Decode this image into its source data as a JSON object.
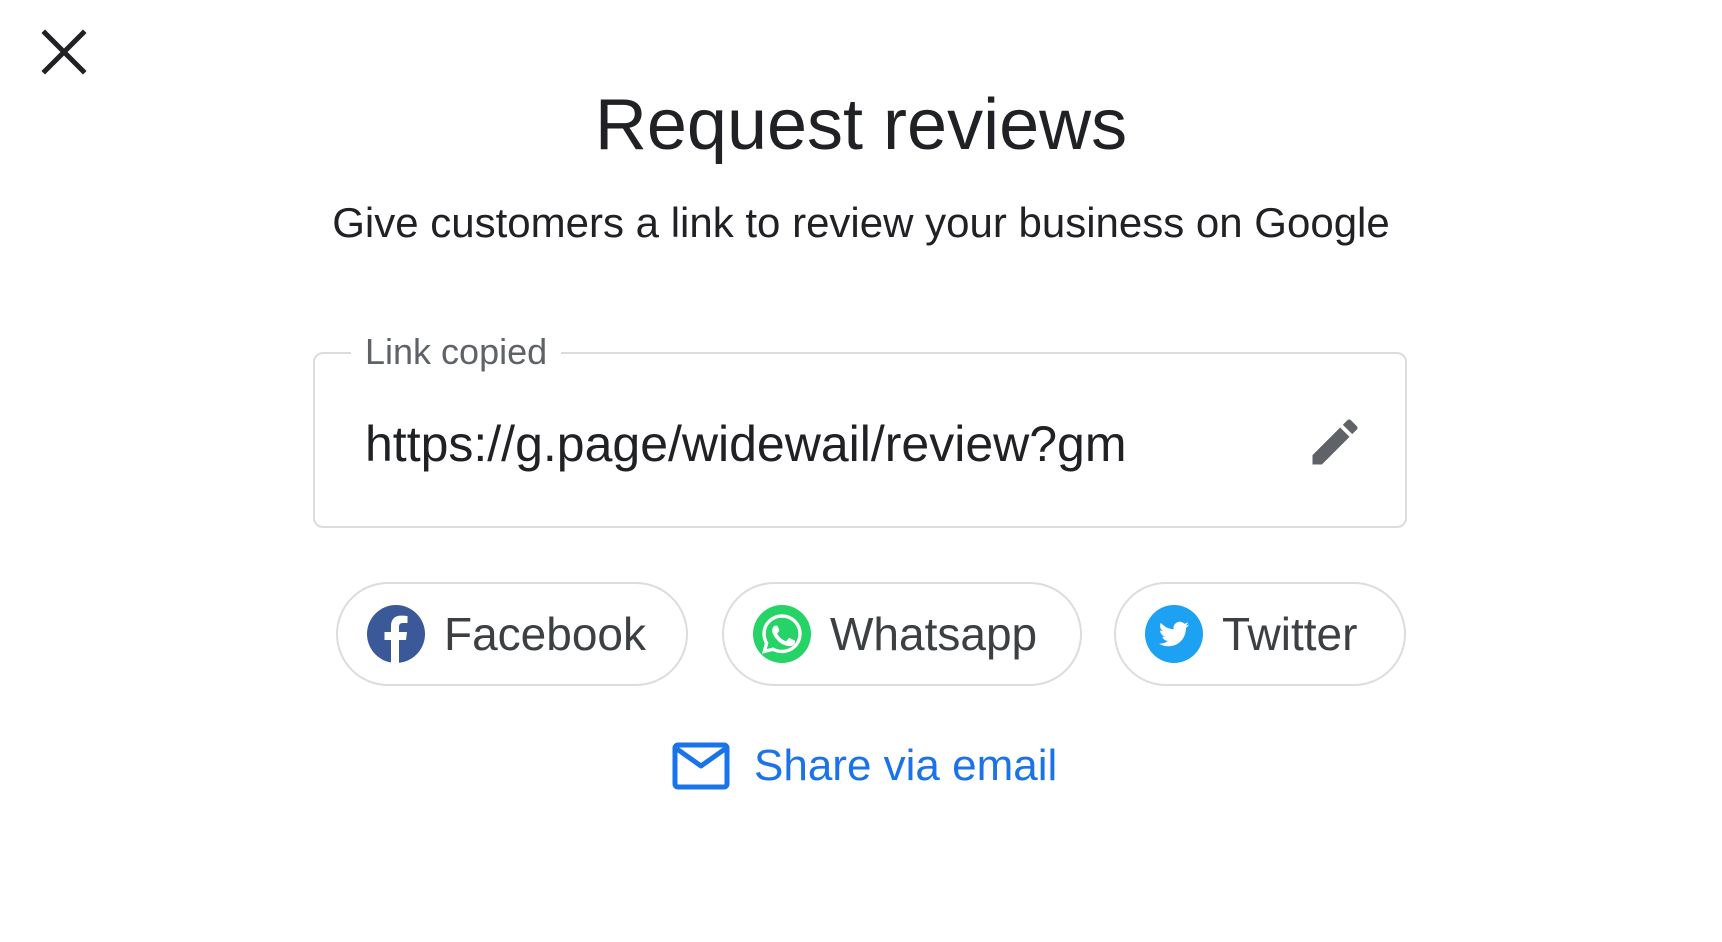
{
  "dialog": {
    "title": "Request reviews",
    "subtitle": "Give customers a link to review your business on Google"
  },
  "link_field": {
    "label": "Link copied",
    "value": "https://g.page/widewail/review?gm"
  },
  "share_buttons": [
    {
      "label": "Facebook",
      "icon": "facebook-icon",
      "color": "#3b5998"
    },
    {
      "label": "Whatsapp",
      "icon": "whatsapp-icon",
      "color": "#25d366"
    },
    {
      "label": "Twitter",
      "icon": "twitter-icon",
      "color": "#1da1f2"
    }
  ],
  "email_share": {
    "label": "Share via email",
    "icon": "mail-icon",
    "color": "#1a73e8"
  },
  "icons": {
    "close": "close-icon",
    "edit": "pencil-icon"
  }
}
